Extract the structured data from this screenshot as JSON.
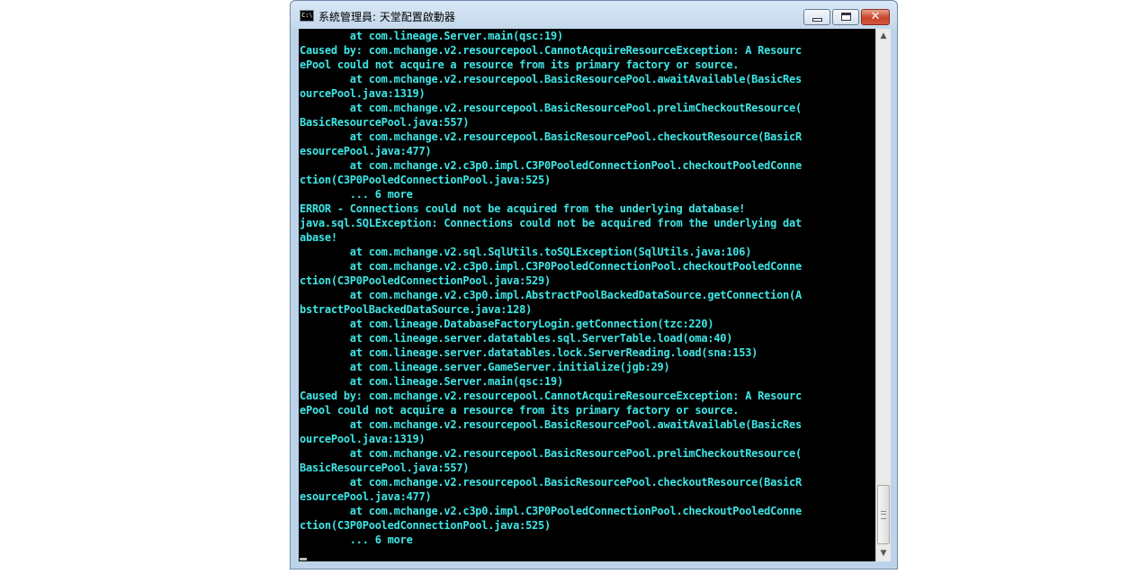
{
  "window": {
    "title": "系統管理員:  天堂配置啟動器",
    "icon_text": "C:\\",
    "controls": {
      "minimize": "minimize",
      "maximize": "maximize",
      "close": "✕"
    }
  },
  "console": {
    "text_color": "#3ee6e6",
    "background": "#000000",
    "lines": [
      "        at com.lineage.Server.main(qsc:19)",
      "Caused by: com.mchange.v2.resourcepool.CannotAcquireResourceException: A Resourc",
      "ePool could not acquire a resource from its primary factory or source.",
      "        at com.mchange.v2.resourcepool.BasicResourcePool.awaitAvailable(BasicRes",
      "ourcePool.java:1319)",
      "        at com.mchange.v2.resourcepool.BasicResourcePool.prelimCheckoutResource(",
      "BasicResourcePool.java:557)",
      "        at com.mchange.v2.resourcepool.BasicResourcePool.checkoutResource(BasicR",
      "esourcePool.java:477)",
      "        at com.mchange.v2.c3p0.impl.C3P0PooledConnectionPool.checkoutPooledConne",
      "ction(C3P0PooledConnectionPool.java:525)",
      "        ... 6 more",
      "ERROR - Connections could not be acquired from the underlying database!",
      "java.sql.SQLException: Connections could not be acquired from the underlying dat",
      "abase!",
      "        at com.mchange.v2.sql.SqlUtils.toSQLException(SqlUtils.java:106)",
      "        at com.mchange.v2.c3p0.impl.C3P0PooledConnectionPool.checkoutPooledConne",
      "ction(C3P0PooledConnectionPool.java:529)",
      "        at com.mchange.v2.c3p0.impl.AbstractPoolBackedDataSource.getConnection(A",
      "bstractPoolBackedDataSource.java:128)",
      "        at com.lineage.DatabaseFactoryLogin.getConnection(tzc:220)",
      "        at com.lineage.server.datatables.sql.ServerTable.load(oma:40)",
      "        at com.lineage.server.datatables.lock.ServerReading.load(sna:153)",
      "        at com.lineage.server.GameServer.initialize(jgb:29)",
      "        at com.lineage.Server.main(qsc:19)",
      "Caused by: com.mchange.v2.resourcepool.CannotAcquireResourceException: A Resourc",
      "ePool could not acquire a resource from its primary factory or source.",
      "        at com.mchange.v2.resourcepool.BasicResourcePool.awaitAvailable(BasicRes",
      "ourcePool.java:1319)",
      "        at com.mchange.v2.resourcepool.BasicResourcePool.prelimCheckoutResource(",
      "BasicResourcePool.java:557)",
      "        at com.mchange.v2.resourcepool.BasicResourcePool.checkoutResource(BasicR",
      "esourcePool.java:477)",
      "        at com.mchange.v2.c3p0.impl.C3P0PooledConnectionPool.checkoutPooledConne",
      "ction(C3P0PooledConnectionPool.java:525)",
      "        ... 6 more"
    ]
  },
  "scrollbar": {
    "up_arrow": "▲",
    "down_arrow": "▼",
    "scroll_position_fraction": 0.93
  }
}
